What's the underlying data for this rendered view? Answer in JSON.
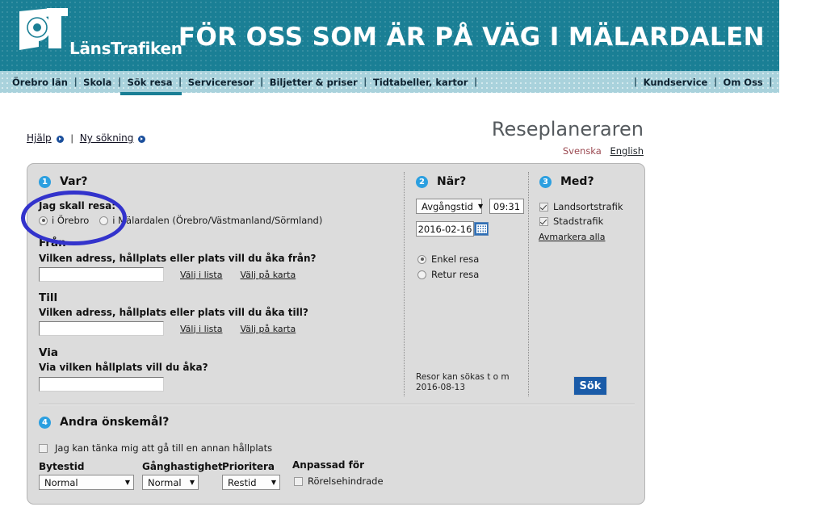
{
  "header": {
    "logo_text": "LänsTrafiken",
    "slogan": "FÖR OSS SOM ÄR PÅ VÄG I MÄLARDALEN"
  },
  "nav": {
    "left_items": [
      {
        "label": "Örebro län",
        "active": false
      },
      {
        "label": "Skola",
        "active": false
      },
      {
        "label": "Sök resa",
        "active": true
      },
      {
        "label": "Serviceresor",
        "active": false
      },
      {
        "label": "Biljetter & priser",
        "active": false
      },
      {
        "label": "Tidtabeller, kartor",
        "active": false
      }
    ],
    "right_items": [
      {
        "label": "Kundservice"
      },
      {
        "label": "Om Oss"
      }
    ],
    "separator": "|"
  },
  "toplinks": {
    "help": "Hjälp",
    "separator": "|",
    "new_search": "Ny sökning"
  },
  "title": {
    "heading": "Reseplaneraren",
    "lang_sv": "Svenska",
    "lang_en": "English"
  },
  "step1": {
    "number": "1",
    "title": "Var?",
    "travel_label": "Jag skall resa:",
    "radio_orebro": "i Örebro",
    "radio_malardalen": "i Mälardalen (Örebro/Västmanland/Sörmland)",
    "radio_selected": "i Örebro",
    "from_heading": "Från",
    "from_question": "Vilken adress, hållplats eller plats vill du åka från?",
    "from_value": "",
    "to_heading": "Till",
    "to_question": "Vilken adress, hållplats eller plats vill du åka till?",
    "to_value": "",
    "via_heading": "Via",
    "via_question": "Via vilken hållplats vill du åka?",
    "via_value": "",
    "pick_list": "Välj i lista",
    "pick_map": "Välj på karta"
  },
  "step2": {
    "number": "2",
    "title": "När?",
    "time_type": "Avgångstid",
    "time_value": "09:31",
    "date_value": "2016-02-16",
    "calendar_icon": "calendar-icon",
    "trip_single": "Enkel resa",
    "trip_return": "Retur resa",
    "trip_selected": "Enkel resa",
    "note_line1": "Resor kan sökas t o m",
    "note_line2": "2016-08-13"
  },
  "step3": {
    "number": "3",
    "title": "Med?",
    "check_rural": "Landsortstrafik",
    "check_rural_on": true,
    "check_city": "Stadstrafik",
    "check_city_on": true,
    "clear_all": "Avmarkera alla",
    "search_button": "Sök"
  },
  "step4": {
    "number": "4",
    "title": "Andra önskemål?",
    "walk_other_stop": "Jag kan tänka mig att gå till en annan hållplats",
    "walk_other_stop_on": false,
    "changetime_label": "Bytestid",
    "changetime_value": "Normal",
    "walkspeed_label": "Gånghastighet",
    "walkspeed_value": "Normal",
    "prioritize_label": "Prioritera",
    "prioritize_value": "Restid",
    "adapted_label": "Anpassad för",
    "adapted_option": "Rörelsehindrade",
    "adapted_on": false
  },
  "colors": {
    "header_teal": "#1a7f95",
    "nav_light": "#a9d2dc",
    "panel_gray": "#dcdcdc",
    "accent_blue": "#2b9fe0",
    "button_blue": "#1a5ba8",
    "annotation_blue": "#3333cc"
  }
}
